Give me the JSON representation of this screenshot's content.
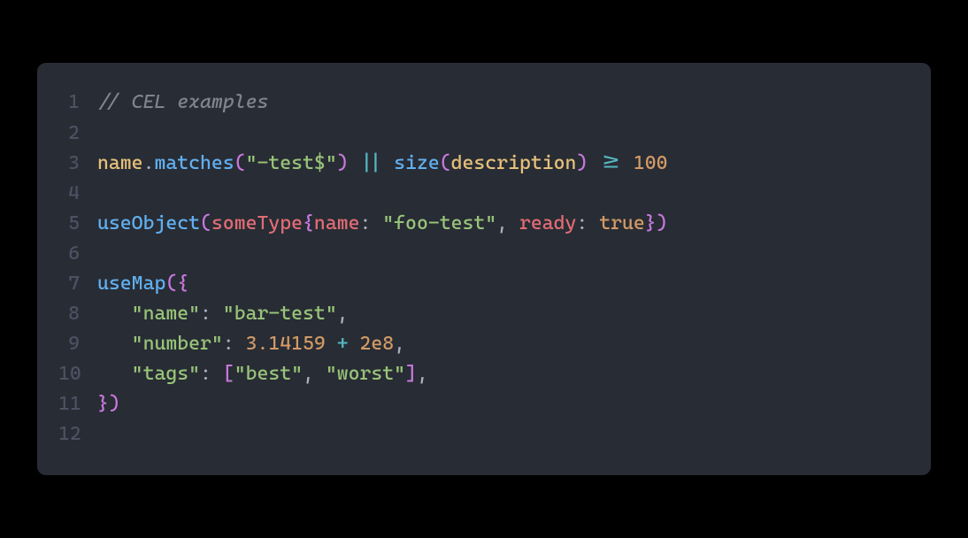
{
  "code": {
    "lines": [
      {
        "n": "1",
        "tokens": [
          {
            "cls": "t-comment",
            "t": "// CEL examples"
          }
        ]
      },
      {
        "n": "2",
        "tokens": []
      },
      {
        "n": "3",
        "tokens": [
          {
            "cls": "t-ident",
            "t": "name"
          },
          {
            "cls": "t-punct",
            "t": "."
          },
          {
            "cls": "t-func",
            "t": "matches"
          },
          {
            "cls": "t-brace",
            "t": "("
          },
          {
            "cls": "t-string",
            "t": "\"-test$\""
          },
          {
            "cls": "t-brace",
            "t": ")"
          },
          {
            "cls": "t-punct",
            "t": " "
          },
          {
            "cls": "t-op",
            "t": "||"
          },
          {
            "cls": "t-punct",
            "t": " "
          },
          {
            "cls": "t-func",
            "t": "size"
          },
          {
            "cls": "t-brace",
            "t": "("
          },
          {
            "cls": "t-ident",
            "t": "description"
          },
          {
            "cls": "t-brace",
            "t": ")"
          },
          {
            "cls": "t-punct",
            "t": " "
          },
          {
            "cls": "t-op",
            "t": ">="
          },
          {
            "cls": "t-punct",
            "t": " "
          },
          {
            "cls": "t-number",
            "t": "100"
          }
        ]
      },
      {
        "n": "4",
        "tokens": []
      },
      {
        "n": "5",
        "tokens": [
          {
            "cls": "t-func",
            "t": "useObject"
          },
          {
            "cls": "t-brace",
            "t": "("
          },
          {
            "cls": "t-type",
            "t": "someType"
          },
          {
            "cls": "t-brace",
            "t": "{"
          },
          {
            "cls": "t-key",
            "t": "name"
          },
          {
            "cls": "t-punct",
            "t": ": "
          },
          {
            "cls": "t-string",
            "t": "\"foo-test\""
          },
          {
            "cls": "t-punct",
            "t": ", "
          },
          {
            "cls": "t-key",
            "t": "ready"
          },
          {
            "cls": "t-punct",
            "t": ": "
          },
          {
            "cls": "t-bool",
            "t": "true"
          },
          {
            "cls": "t-brace",
            "t": "})"
          }
        ]
      },
      {
        "n": "6",
        "tokens": []
      },
      {
        "n": "7",
        "tokens": [
          {
            "cls": "t-func",
            "t": "useMap"
          },
          {
            "cls": "t-brace",
            "t": "({"
          }
        ]
      },
      {
        "n": "8",
        "tokens": [
          {
            "cls": "t-punct",
            "t": "   "
          },
          {
            "cls": "t-string",
            "t": "\"name\""
          },
          {
            "cls": "t-punct",
            "t": ": "
          },
          {
            "cls": "t-string",
            "t": "\"bar-test\""
          },
          {
            "cls": "t-punct",
            "t": ","
          }
        ]
      },
      {
        "n": "9",
        "tokens": [
          {
            "cls": "t-punct",
            "t": "   "
          },
          {
            "cls": "t-string",
            "t": "\"number\""
          },
          {
            "cls": "t-punct",
            "t": ": "
          },
          {
            "cls": "t-number",
            "t": "3.14159"
          },
          {
            "cls": "t-punct",
            "t": " "
          },
          {
            "cls": "t-op",
            "t": "+"
          },
          {
            "cls": "t-punct",
            "t": " "
          },
          {
            "cls": "t-number",
            "t": "2e8"
          },
          {
            "cls": "t-punct",
            "t": ","
          }
        ]
      },
      {
        "n": "10",
        "tokens": [
          {
            "cls": "t-punct",
            "t": "   "
          },
          {
            "cls": "t-string",
            "t": "\"tags\""
          },
          {
            "cls": "t-punct",
            "t": ": "
          },
          {
            "cls": "t-brace",
            "t": "["
          },
          {
            "cls": "t-string",
            "t": "\"best\""
          },
          {
            "cls": "t-punct",
            "t": ", "
          },
          {
            "cls": "t-string",
            "t": "\"worst\""
          },
          {
            "cls": "t-brace",
            "t": "]"
          },
          {
            "cls": "t-punct",
            "t": ","
          }
        ]
      },
      {
        "n": "11",
        "tokens": [
          {
            "cls": "t-brace",
            "t": "})"
          }
        ]
      },
      {
        "n": "12",
        "tokens": []
      }
    ]
  }
}
